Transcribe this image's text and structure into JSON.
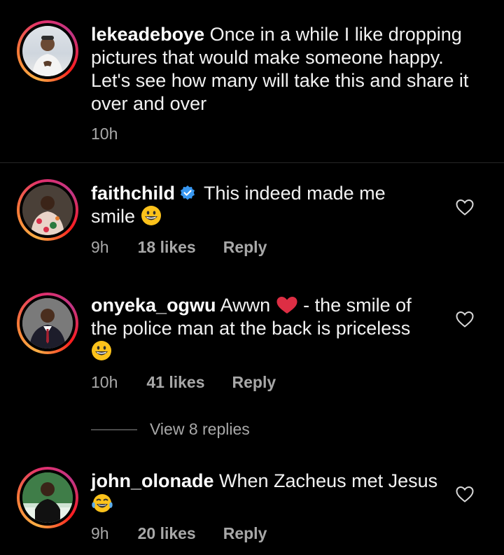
{
  "post": {
    "username": "lekeadeboye",
    "caption": "Once in a while I like dropping pictures that would make someone happy. Let's see how many will take this and share it over and over",
    "time": "10h"
  },
  "comments": [
    {
      "username": "faithchild",
      "verified": true,
      "text": "This indeed made me smile",
      "emoji": "grinning-face",
      "time": "9h",
      "likes": "18 likes",
      "reply": "Reply"
    },
    {
      "username": "onyeka_ogwu",
      "text_before": "Awwn",
      "emoji_inline": "red-heart",
      "text_after": "- the smile of the police man at the back is priceless",
      "emoji": "grinning-face",
      "time": "10h",
      "likes": "41 likes",
      "reply": "Reply",
      "view_replies": "View 8 replies"
    },
    {
      "username": "john_olonade",
      "text": "When Zacheus met Jesus",
      "emoji": "face-with-tears-of-joy",
      "time": "9h",
      "likes": "20 likes",
      "reply": "Reply"
    }
  ],
  "colors": {
    "background": "#000000",
    "text": "#f5f5f5",
    "muted": "#a8a8a8",
    "verified": "#3897f0",
    "heart": "#e0245e"
  },
  "icons": {
    "like": "heart-outline-icon",
    "verified": "verified-badge-icon"
  }
}
